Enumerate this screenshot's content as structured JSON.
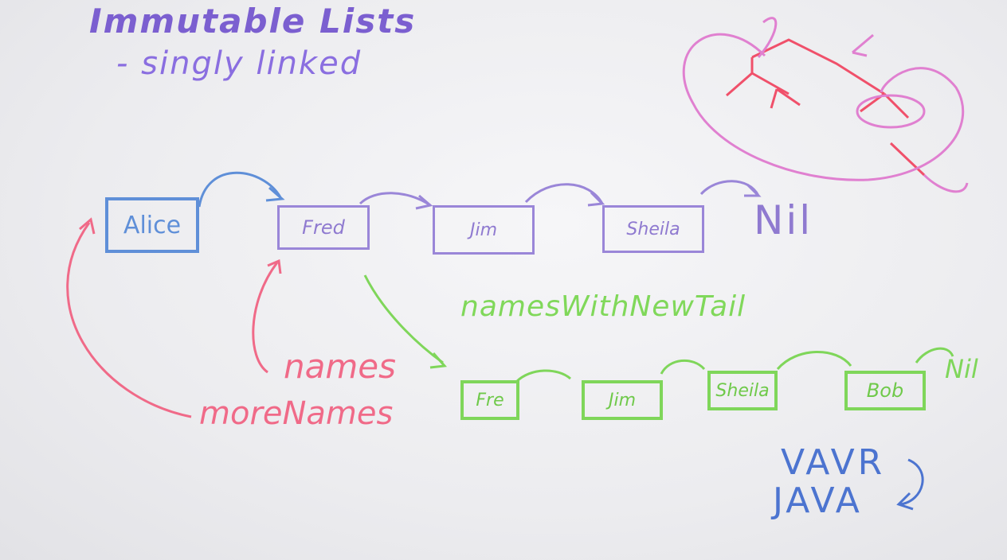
{
  "title": "Immutable Lists",
  "subtitle": "- singly linked",
  "list_nodes": [
    "Alice",
    "Fred",
    "Jim",
    "Sheila"
  ],
  "list_end": "Nil",
  "new_tail_label": "namesWithNewTail",
  "new_list_nodes": [
    "Fre",
    "Jim",
    "Sheila",
    "Bob"
  ],
  "new_list_end": "Nil",
  "pointer_labels": {
    "names": "names",
    "more_names": "moreNames"
  },
  "library": {
    "top": "VAVR",
    "bottom": "JAVA"
  },
  "colors": {
    "title": "#7b5fd0",
    "alice": "#5f8fd8",
    "list": "#9a86d8",
    "new_list": "#7fd65a",
    "pointers": "#f06a88",
    "tree": "#f0506a",
    "tree_loop": "#e080d0",
    "library": "#4c74d0"
  }
}
